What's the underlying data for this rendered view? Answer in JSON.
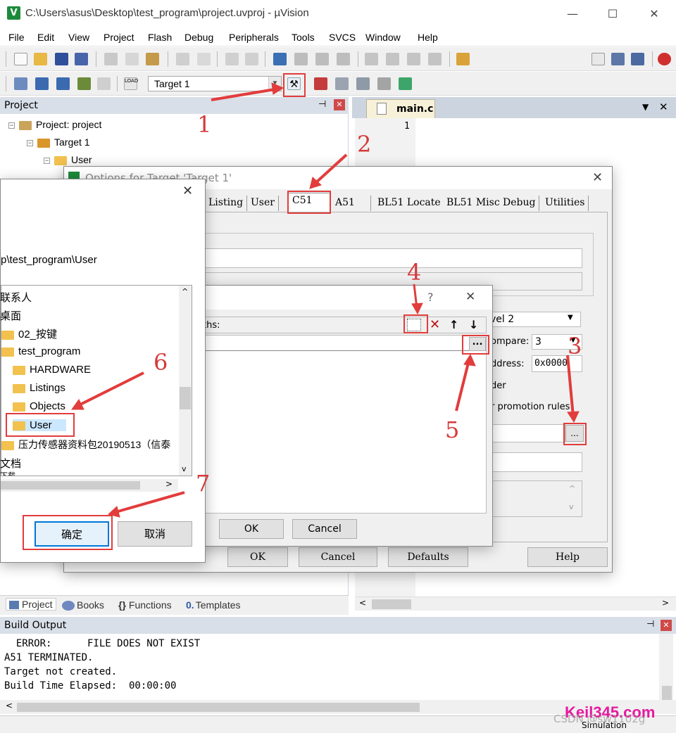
{
  "window": {
    "icon_text": "V",
    "title": "C:\\Users\\asus\\Desktop\\test_program\\project.uvproj - µVision",
    "minimize": "—",
    "maximize": "☐",
    "close": "✕"
  },
  "menu": [
    "File",
    "Edit",
    "View",
    "Project",
    "Flash",
    "Debug",
    "Peripherals",
    "Tools",
    "SVCS",
    "Window",
    "Help"
  ],
  "toolbar": {
    "target": "Target 1",
    "load_label": "LOAD"
  },
  "project_panel": {
    "title": "Project",
    "pin": "ᵖ",
    "close": "✕",
    "tree": {
      "root": "Project: project",
      "target": "Target 1",
      "group": "User"
    },
    "tabs": [
      "Project",
      "Books",
      "Functions",
      "Templates"
    ],
    "functions_glyph": "{}",
    "templates_glyph": "0."
  },
  "editor": {
    "tab": "main.c",
    "line_number": "1",
    "dropdown": "▼",
    "close": "✕"
  },
  "options_dialog": {
    "title": "Options for Target 'Target 1'",
    "tabs": [
      "Listing",
      "User",
      "C51",
      "A51",
      "BL51 Locate",
      "BL51 Misc",
      "Debug",
      "Utilities"
    ],
    "level_value": "vel 2",
    "compare_label": "ompare:",
    "compare_value": "3",
    "address_label": "ddress:",
    "address_value": "0x0000",
    "order_label": "der",
    "promotion_label": "r promotion rules",
    "browse_btn": "...",
    "buttons": {
      "ok": "OK",
      "cancel": "Cancel",
      "defaults": "Defaults",
      "help": "Help"
    }
  },
  "paths_dialog": {
    "help_q": "?",
    "close": "✕",
    "label": "ths:",
    "browse_btn": "...",
    "ok": "OK",
    "cancel": "Cancel"
  },
  "browse_dialog": {
    "close": "✕",
    "path": "p\\test_program\\User",
    "items": [
      "联系人",
      "桌面",
      "02_按键",
      "test_program",
      "HARDWARE",
      "Listings",
      "Objects",
      "User",
      "压力传感器资料包20190513（信泰",
      "文档",
      "下载"
    ],
    "ok": "确定",
    "cancel": "取消"
  },
  "build_output": {
    "title": "Build Output",
    "lines": [
      "  ERROR:      FILE DOES NOT EXIST",
      "A51 TERMINATED.",
      "Target not created.",
      "Build Time Elapsed:  00:00:00"
    ]
  },
  "status": {
    "simulation": "Simulation"
  },
  "annotations": [
    "1",
    "2",
    "3",
    "4",
    "5",
    "6",
    "7"
  ],
  "watermarks": {
    "site": "Keil345.com",
    "csdn": "CSDN @sw1102g"
  },
  "colors": {
    "annotation_red": "#e23c3c",
    "panel_header": "#d9dfe8",
    "watermark_pink": "#e51aa0"
  }
}
